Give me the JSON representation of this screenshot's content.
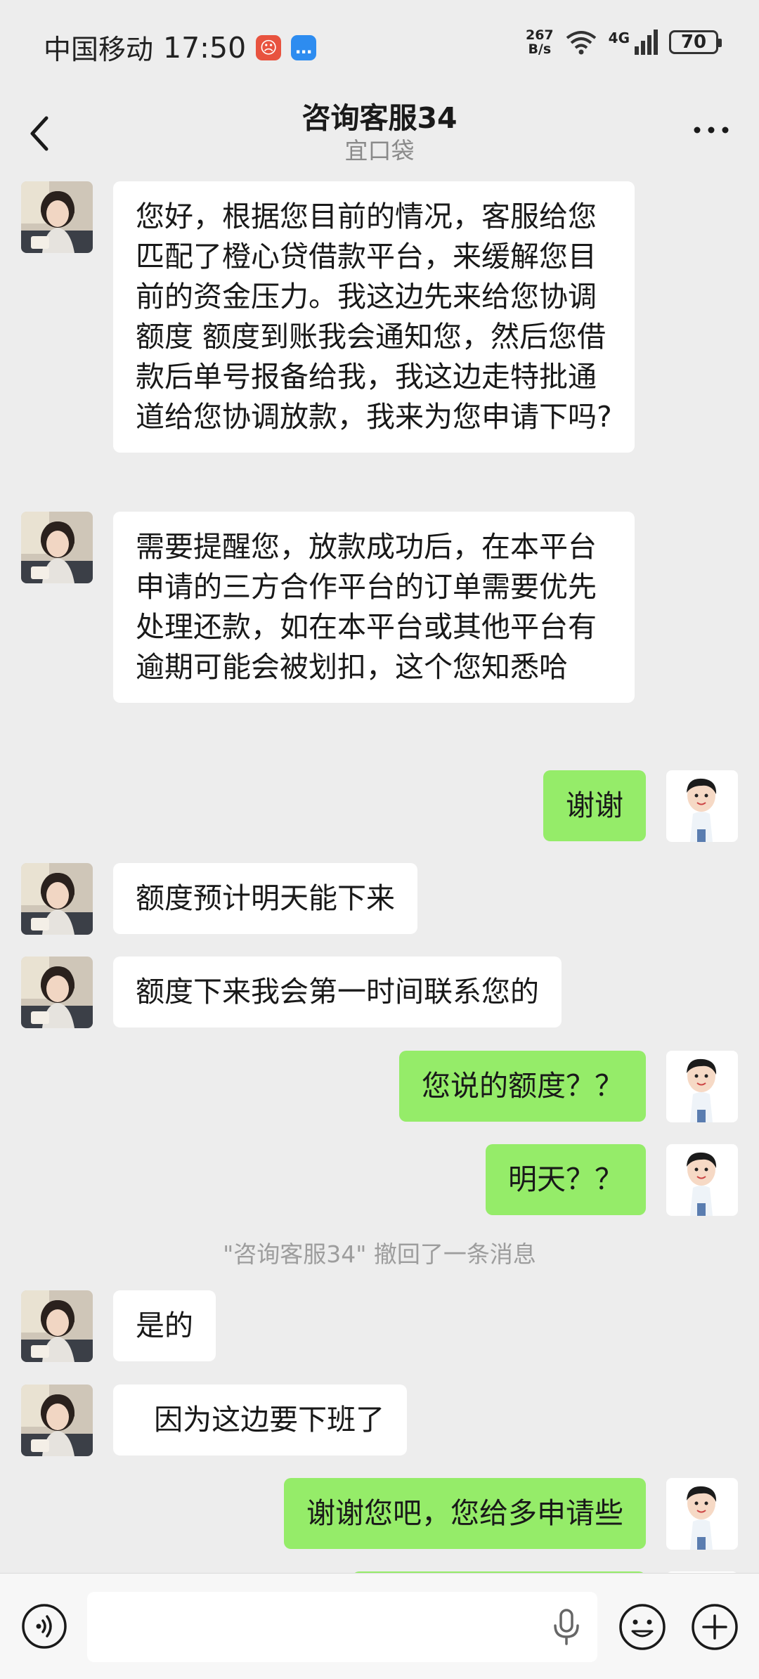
{
  "status_bar": {
    "carrier": "中国移动",
    "time": "17:50",
    "net_speed_value": "267",
    "net_speed_unit": "B/s",
    "network": "4G",
    "battery": "70"
  },
  "header": {
    "title": "咨询客服34",
    "subtitle": "宜口袋"
  },
  "messages": [
    {
      "side": "left",
      "text": "您好，根据您目前的情况，客服给您匹配了橙心贷借款平台，来缓解您目前的资金压力。我这边先来给您协调额度 额度到账我会通知您，然后您借款后单号报备给我，我这边走特批通道给您协调放款，我来为您申请下吗?"
    },
    {
      "side": "left",
      "text": "需要提醒您，放款成功后，在本平台申请的三方合作平台的订单需要优先处理还款，如在本平台或其他平台有逾期可能会被划扣，这个您知悉哈"
    },
    {
      "side": "right",
      "text": "谢谢"
    },
    {
      "side": "left",
      "text": "额度预计明天能下来"
    },
    {
      "side": "left",
      "text": "额度下来我会第一时间联系您的"
    },
    {
      "side": "right",
      "text": "您说的额度？？"
    },
    {
      "side": "right",
      "text": "明天？？"
    },
    {
      "side": "system",
      "text": "\"咨询客服34\" 撤回了一条消息"
    },
    {
      "side": "left",
      "text": "是的"
    },
    {
      "side": "left",
      "text": "  因为这边要下班了"
    },
    {
      "side": "right",
      "text": "谢谢您吧，您给多申请些"
    }
  ],
  "colors": {
    "background": "#ededed",
    "sent_bubble": "#95ec69",
    "received_bubble": "#ffffff",
    "system_text": "#9d9d9d"
  },
  "icons": {
    "back": "chevron-left-icon",
    "more": "more-dots-icon",
    "voice": "voice-mode-icon",
    "mic": "microphone-icon",
    "emoji": "emoji-icon",
    "plus": "plus-icon"
  }
}
